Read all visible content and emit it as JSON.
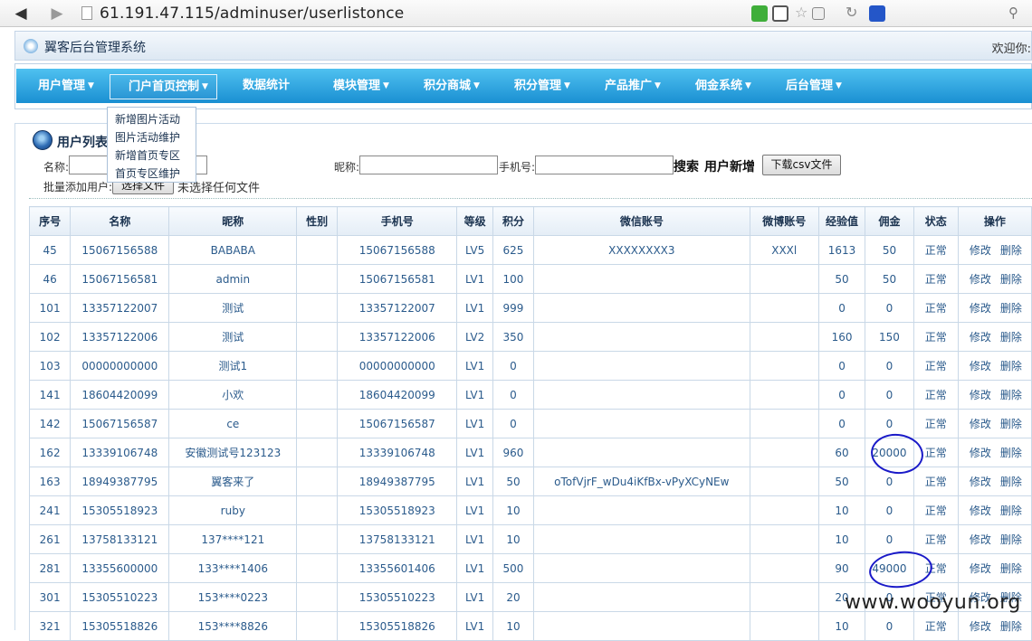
{
  "browser": {
    "url": "61.191.47.115/adminuser/userlistonce"
  },
  "header": {
    "title": "翼客后台管理系统",
    "welcome": "欢迎你:"
  },
  "nav": {
    "items": [
      "用户管理",
      "门户首页控制",
      "数据统计",
      "模块管理",
      "积分商城",
      "积分管理",
      "产品推广",
      "佣金系统",
      "后台管理"
    ],
    "dropdown": [
      "新增图片活动",
      "图片活动维护",
      "新增首页专区",
      "首页专区维护"
    ]
  },
  "section": {
    "title": "用户列表"
  },
  "filters": {
    "name_label": "名称:",
    "nickname_label": "昵称:",
    "phone_label": "手机号:",
    "search_label": "搜索",
    "add_label": "用户新增",
    "csv_label": "下载csv文件",
    "bulk_label": "批量添加用户:",
    "file_button": "选择文件",
    "file_status": "未选择任何文件"
  },
  "table": {
    "headers": [
      "序号",
      "名称",
      "昵称",
      "性别",
      "手机号",
      "等级",
      "积分",
      "微信账号",
      "微博账号",
      "经验值",
      "佣金",
      "状态",
      "操作"
    ],
    "edit_label": "修改",
    "delete_label": "删除",
    "rows": [
      [
        "45",
        "15067156588",
        "BABABA",
        "",
        "15067156588",
        "LV5",
        "625",
        "XXXXXXXX3",
        "XXXl",
        "1613",
        "50",
        "正常"
      ],
      [
        "46",
        "15067156581",
        "admin",
        "",
        "15067156581",
        "LV1",
        "100",
        "",
        "",
        "50",
        "50",
        "正常"
      ],
      [
        "101",
        "13357122007",
        "测试",
        "",
        "13357122007",
        "LV1",
        "999",
        "",
        "",
        "0",
        "0",
        "正常"
      ],
      [
        "102",
        "13357122006",
        "测试",
        "",
        "13357122006",
        "LV2",
        "350",
        "",
        "",
        "160",
        "150",
        "正常"
      ],
      [
        "103",
        "00000000000",
        "测试1",
        "",
        "00000000000",
        "LV1",
        "0",
        "",
        "",
        "0",
        "0",
        "正常"
      ],
      [
        "141",
        "18604420099",
        "小欢",
        "",
        "18604420099",
        "LV1",
        "0",
        "",
        "",
        "0",
        "0",
        "正常"
      ],
      [
        "142",
        "15067156587",
        "ce",
        "",
        "15067156587",
        "LV1",
        "0",
        "",
        "",
        "0",
        "0",
        "正常"
      ],
      [
        "162",
        "13339106748",
        "安徽测试号123123",
        "",
        "13339106748",
        "LV1",
        "960",
        "",
        "",
        "60",
        "20000",
        "正常"
      ],
      [
        "163",
        "18949387795",
        "翼客来了",
        "",
        "18949387795",
        "LV1",
        "50",
        "oTofVjrF_wDu4iKfBx-vPyXCyNEw",
        "",
        "50",
        "0",
        "正常"
      ],
      [
        "241",
        "15305518923",
        "ruby",
        "",
        "15305518923",
        "LV1",
        "10",
        "",
        "",
        "10",
        "0",
        "正常"
      ],
      [
        "261",
        "13758133121",
        "137****121",
        "",
        "13758133121",
        "LV1",
        "10",
        "",
        "",
        "10",
        "0",
        "正常"
      ],
      [
        "281",
        "13355600000",
        "133****1406",
        "",
        "13355601406",
        "LV1",
        "500",
        "",
        "",
        "90",
        "49000",
        "正常"
      ],
      [
        "301",
        "15305510223",
        "153****0223",
        "",
        "15305510223",
        "LV1",
        "20",
        "",
        "",
        "20",
        "0",
        "正常"
      ],
      [
        "321",
        "15305518826",
        "153****8826",
        "",
        "15305518826",
        "LV1",
        "10",
        "",
        "",
        "10",
        "0",
        "正常"
      ]
    ]
  },
  "watermark": "www.wooyun.org",
  "colors": {
    "nav_top": "#4fc1f0",
    "nav_bottom": "#1a8fd2",
    "link": "#2b5b8c",
    "annotation": "#1a1ac8"
  }
}
